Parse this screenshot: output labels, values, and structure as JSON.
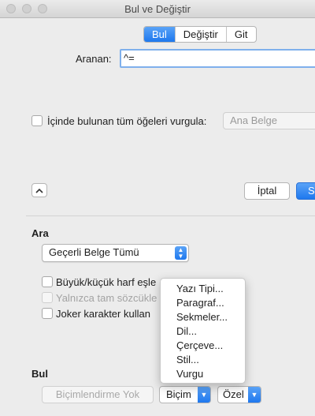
{
  "window": {
    "title": "Bul ve Değiştir"
  },
  "tabs": [
    {
      "label": "Bul",
      "active": true
    },
    {
      "label": "Değiştir",
      "active": false
    },
    {
      "label": "Git",
      "active": false
    }
  ],
  "search": {
    "label": "Aranan:",
    "value": "^="
  },
  "highlight": {
    "label": "İçinde bulunan tüm öğeleri vurgula:",
    "scope": "Ana Belge"
  },
  "buttons": {
    "cancel": "İptal",
    "find": "S"
  },
  "ara": {
    "heading": "Ara",
    "scope": "Geçerli Belge Tümü",
    "options": [
      {
        "label": "Büyük/küçük harf eşle",
        "enabled": true
      },
      {
        "label": "Yalnızca tam sözcükle",
        "enabled": false
      },
      {
        "label": "Joker karakter kullan",
        "enabled": true
      }
    ]
  },
  "bul": {
    "heading": "Bul",
    "no_format": "Biçimlendirme Yok",
    "format": "Biçim",
    "special": "Özel"
  },
  "format_menu": [
    "Yazı Tipi...",
    "Paragraf...",
    "Sekmeler...",
    "Dil...",
    "Çerçeve...",
    "Stil...",
    "Vurgu"
  ],
  "colors": {
    "accent": "#1e78ee"
  }
}
